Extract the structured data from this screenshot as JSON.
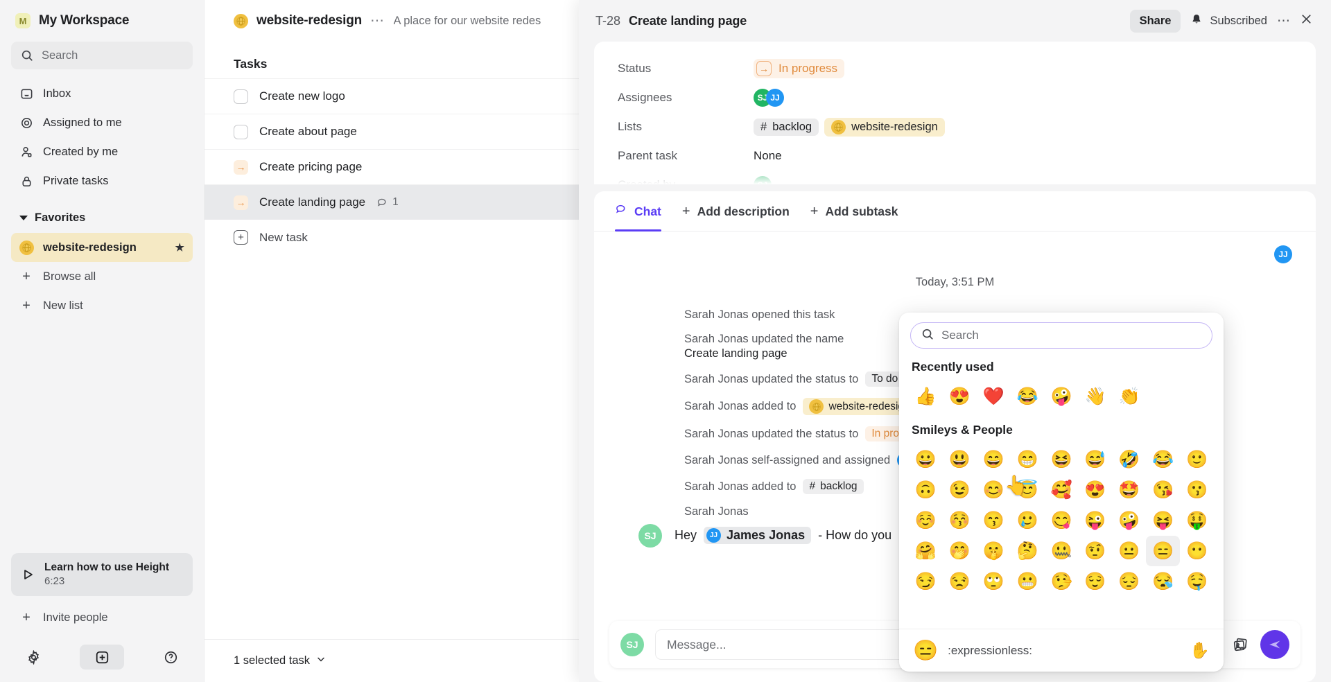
{
  "sidebar": {
    "workspace": {
      "badge": "M",
      "title": "My Workspace"
    },
    "search_placeholder": "Search",
    "nav": [
      {
        "label": "Inbox",
        "icon": "inbox-icon"
      },
      {
        "label": "Assigned to me",
        "icon": "target-icon"
      },
      {
        "label": "Created by me",
        "icon": "person-icon"
      },
      {
        "label": "Private tasks",
        "icon": "lock-icon"
      }
    ],
    "favorites_label": "Favorites",
    "favorite_item": "website-redesign",
    "browse_all": "Browse all",
    "new_list": "New list",
    "learn": {
      "title": "Learn how to use Height",
      "duration": "6:23"
    },
    "invite": "Invite people"
  },
  "tasklist": {
    "list_name": "website-redesign",
    "list_description": "A place for our website redes",
    "section_label": "Tasks",
    "rows": [
      {
        "label": "Create new logo",
        "state": "todo",
        "comments": ""
      },
      {
        "label": "Create about page",
        "state": "todo",
        "comments": ""
      },
      {
        "label": "Create pricing page",
        "state": "inprogress",
        "comments": ""
      },
      {
        "label": "Create landing page",
        "state": "inprogress",
        "comments": "1"
      }
    ],
    "new_task": "New task",
    "footer": "1 selected task"
  },
  "detail": {
    "task_id": "T-28",
    "task_name": "Create landing page",
    "share_label": "Share",
    "subscribed_label": "Subscribed",
    "props": [
      {
        "label": "Status",
        "value": "In progress"
      },
      {
        "label": "Assignees",
        "value": ""
      },
      {
        "label": "Lists",
        "value": ""
      },
      {
        "label": "Parent task",
        "value": "None"
      },
      {
        "label": "Created by",
        "value": ""
      }
    ],
    "status_value": "In progress",
    "lists": [
      {
        "label": "backlog",
        "kind": "hash"
      },
      {
        "label": "website-redesign",
        "kind": "site"
      }
    ],
    "parent_task": "None",
    "assignee_initials": [
      "SJ",
      "JJ"
    ],
    "tabs": [
      {
        "label": "Chat",
        "icon": "chat-icon",
        "active": true
      },
      {
        "label": "Add description",
        "icon": "plus-icon",
        "active": false
      },
      {
        "label": "Add subtask",
        "icon": "plus-icon",
        "active": false
      }
    ],
    "timestamp": "Today, 3:51 PM",
    "events": [
      {
        "text": "Sarah Jonas opened this task",
        "chip": "",
        "chip_kind": ""
      },
      {
        "text": "Sarah Jonas updated the name",
        "chip": "",
        "chip_kind": ""
      },
      {
        "text": "Create landing page",
        "chip": "",
        "chip_kind": "",
        "plain": true
      },
      {
        "text": "Sarah Jonas updated the status to",
        "chip": "To do",
        "chip_kind": "plain"
      },
      {
        "text": "Sarah Jonas added to",
        "chip": "website-redesign",
        "chip_kind": "site"
      },
      {
        "text": "Sarah Jonas updated the status to",
        "chip": "In progr",
        "chip_kind": "warm"
      },
      {
        "text": "Sarah Jonas self-assigned and assigned",
        "chip": "JJ",
        "chip_kind": "avatar"
      },
      {
        "text": "Sarah Jonas added to",
        "chip": "backlog",
        "chip_kind": "hash"
      },
      {
        "text": "Sarah Jonas",
        "chip": "",
        "chip_kind": ""
      }
    ],
    "message": {
      "author_initials": "SJ",
      "prefix": "Hey",
      "mention_initials": "JJ",
      "mention_name": "James Jonas",
      "suffix": "- How do you"
    },
    "composer": {
      "avatar": "SJ",
      "placeholder": "Message..."
    }
  },
  "emoji_picker": {
    "search_placeholder": "Search",
    "recent_label": "Recently used",
    "recent": [
      "👍",
      "😍",
      "❤️",
      "😂",
      "🤪",
      "👋",
      "👏"
    ],
    "category_label": "Smileys & People",
    "grid": [
      [
        "😀",
        "😃",
        "😄",
        "😁",
        "😆",
        "😅",
        "🤣",
        "😂",
        "🙂"
      ],
      [
        "🙃",
        "😉",
        "😊",
        "😇",
        "🥰",
        "😍",
        "🤩",
        "😘",
        "😗"
      ],
      [
        "☺️",
        "😚",
        "😙",
        "🥲",
        "😋",
        "😜",
        "🤪",
        "😝",
        "🤑"
      ],
      [
        "🤗",
        "🤭",
        "🤫",
        "🤔",
        "🤐",
        "🤨",
        "😐",
        "😑",
        "😶"
      ],
      [
        "😏",
        "😒",
        "🙄",
        "😬",
        "🤥",
        "😌",
        "😔",
        "😪",
        "🤤"
      ]
    ],
    "highlight": {
      "row": 3,
      "col": 7
    },
    "footer": {
      "emoji": "😑",
      "code": ":expressionless:",
      "hand": "✋"
    }
  },
  "colors": {
    "accent": "#5b3df5",
    "send": "#6035e8",
    "status_orange": "#e08a3c",
    "fav_bg": "#f5e9c4",
    "green": "#21b563",
    "blue": "#2196f3"
  }
}
